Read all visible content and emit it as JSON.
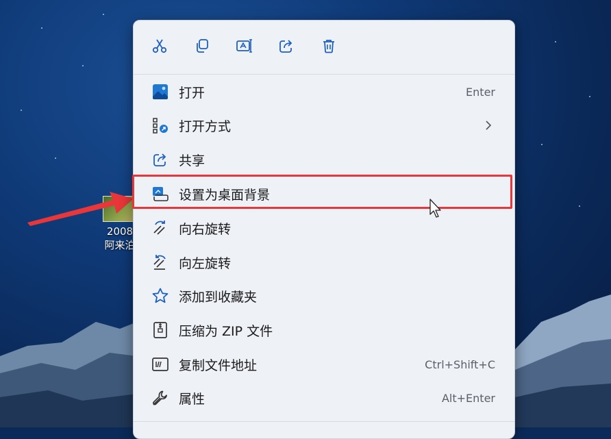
{
  "desktop": {
    "icon_label_1": "2008",
    "icon_label_2": "阿来泊"
  },
  "toolbar": {
    "buttons": [
      {
        "name": "cut-icon"
      },
      {
        "name": "copy-icon"
      },
      {
        "name": "rename-icon"
      },
      {
        "name": "share-icon"
      },
      {
        "name": "delete-icon"
      }
    ]
  },
  "menu": {
    "items": [
      {
        "label": "打开",
        "shortcut": "Enter",
        "icon": "image-icon"
      },
      {
        "label": "打开方式",
        "shortcut": "",
        "icon": "open-with-icon",
        "has_submenu": true
      },
      {
        "label": "共享",
        "shortcut": "",
        "icon": "share-icon"
      },
      {
        "label": "设置为桌面背景",
        "shortcut": "",
        "icon": "wallpaper-icon",
        "highlighted": true
      },
      {
        "label": "向右旋转",
        "shortcut": "",
        "icon": "rotate-right-icon"
      },
      {
        "label": "向左旋转",
        "shortcut": "",
        "icon": "rotate-left-icon"
      },
      {
        "label": "添加到收藏夹",
        "shortcut": "",
        "icon": "star-icon"
      },
      {
        "label": "压缩为 ZIP 文件",
        "shortcut": "",
        "icon": "zip-icon"
      },
      {
        "label": "复制文件地址",
        "shortcut": "Ctrl+Shift+C",
        "icon": "copy-path-icon"
      },
      {
        "label": "属性",
        "shortcut": "Alt+Enter",
        "icon": "wrench-icon"
      }
    ]
  },
  "colors": {
    "highlight_border": "#e8363b",
    "icon_accent": "#1f5fbf",
    "menu_bg": "#eef2f7"
  }
}
